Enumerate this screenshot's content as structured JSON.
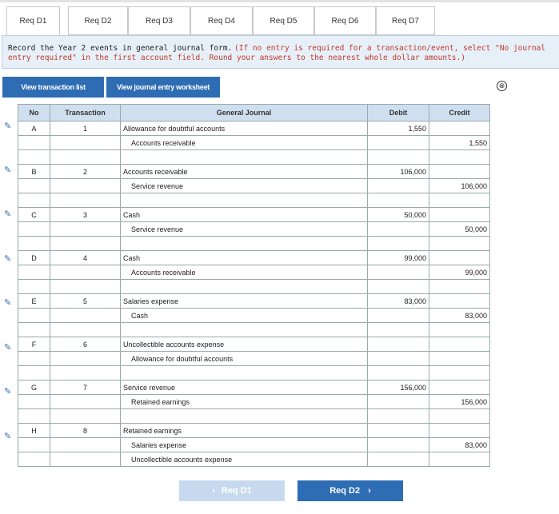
{
  "tabs": [
    {
      "label": "Req D1"
    },
    {
      "label": "Req D2"
    },
    {
      "label": "Req D3"
    },
    {
      "label": "Req D4"
    },
    {
      "label": "Req D5"
    },
    {
      "label": "Req D6"
    },
    {
      "label": "Req D7"
    }
  ],
  "instructions": {
    "main": "Record the Year 2 events in general journal form.",
    "note": "(If no entry is required for a transaction/event, select \"No journal entry required\" in the first account field. Round your answers to the nearest whole dollar amounts.)"
  },
  "buttons": {
    "transactions": "View transaction list",
    "worksheet": "View journal entry worksheet"
  },
  "close_icon": "⊗",
  "table": {
    "headers": {
      "no": "No",
      "transaction": "Transaction",
      "journal": "General Journal",
      "debit": "Debit",
      "credit": "Credit"
    },
    "rows": [
      {
        "no": "A",
        "trx": "1",
        "lines": [
          {
            "acct": "Allowance for doubtful accounts",
            "debit": "1,550",
            "credit": ""
          },
          {
            "acct": "Accounts receivable",
            "debit": "",
            "credit": "1,550"
          }
        ]
      },
      {
        "no": "B",
        "trx": "2",
        "lines": [
          {
            "acct": "Accounts receivable",
            "debit": "106,000",
            "credit": ""
          },
          {
            "acct": "Service revenue",
            "debit": "",
            "credit": "106,000"
          }
        ]
      },
      {
        "no": "C",
        "trx": "3",
        "lines": [
          {
            "acct": "Cash",
            "debit": "50,000",
            "credit": ""
          },
          {
            "acct": "Service revenue",
            "debit": "",
            "credit": "50,000"
          }
        ]
      },
      {
        "no": "D",
        "trx": "4",
        "lines": [
          {
            "acct": "Cash",
            "debit": "99,000",
            "credit": ""
          },
          {
            "acct": "Accounts receivable",
            "debit": "",
            "credit": "99,000"
          }
        ]
      },
      {
        "no": "E",
        "trx": "5",
        "lines": [
          {
            "acct": "Salaries expense",
            "debit": "83,000",
            "credit": ""
          },
          {
            "acct": "Cash",
            "debit": "",
            "credit": "83,000"
          }
        ]
      },
      {
        "no": "F",
        "trx": "6",
        "lines": [
          {
            "acct": "Uncollectible accounts expense",
            "debit": "",
            "credit": ""
          },
          {
            "acct": "Allowance for doubtful accounts",
            "debit": "",
            "credit": ""
          }
        ]
      },
      {
        "no": "G",
        "trx": "7",
        "lines": [
          {
            "acct": "Service revenue",
            "debit": "156,000",
            "credit": ""
          },
          {
            "acct": "Retained earnings",
            "debit": "",
            "credit": "156,000"
          }
        ]
      },
      {
        "no": "H",
        "trx": "8",
        "lines": [
          {
            "acct": "Retained earnings",
            "debit": "",
            "credit": ""
          },
          {
            "acct": "Salaries expense",
            "debit": "",
            "credit": "83,000"
          },
          {
            "acct": "Uncollectible accounts expense",
            "debit": "",
            "credit": ""
          }
        ]
      }
    ]
  },
  "nav": {
    "prev_label": "Req D1",
    "next_label": "Req D2"
  }
}
